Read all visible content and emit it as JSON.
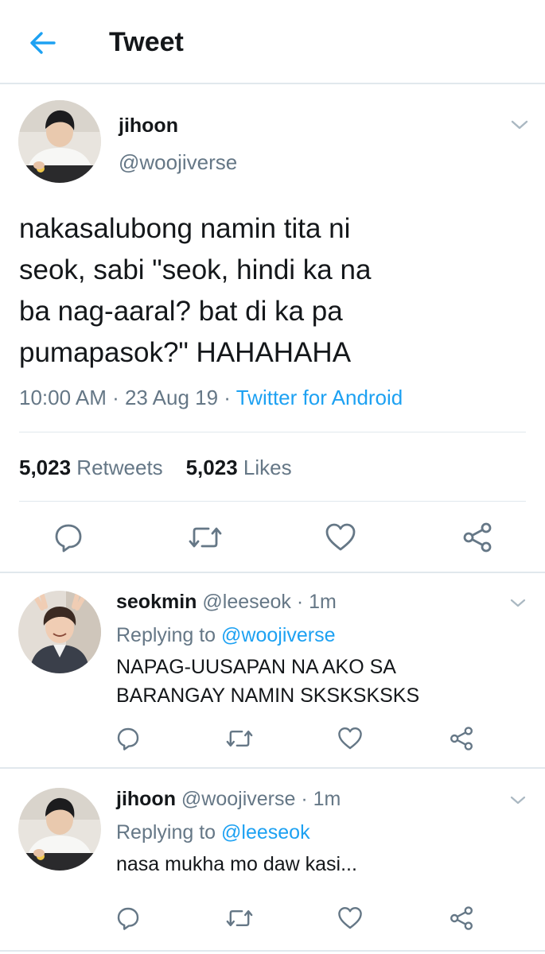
{
  "header": {
    "title": "Tweet"
  },
  "main_tweet": {
    "name": "jihoon",
    "handle": "@woojiverse",
    "text": "nakasalubong namin tita ni\nseok, sabi \"seok, hindi ka na\nba nag-aaral? bat di ka pa\npumapasok?\" HAHAHAHA",
    "time": "10:00 AM · 23 Aug 19 · ",
    "source": "Twitter for Android",
    "retweets_count": "5,023",
    "retweets_label": " Retweets",
    "likes_count": "5,023",
    "likes_label": " Likes"
  },
  "replies": [
    {
      "name": "seokmin",
      "handle_time": " @leeseok · 1m",
      "replying_label": "Replying to ",
      "replying_to": "@woojiverse",
      "text": "NAPAG-UUSAPAN NA AKO SA\nBARANGAY NAMIN SKSKSKSKS"
    },
    {
      "name": "jihoon",
      "handle_time": " @woojiverse · 1m",
      "replying_label": "Replying to ",
      "replying_to": "@leeseok",
      "text": "nasa mukha mo daw kasi..."
    }
  ],
  "icons": {
    "back": "arrow-left-icon",
    "caret": "chevron-down-icon",
    "reply": "reply-icon",
    "retweet": "retweet-icon",
    "like": "heart-icon",
    "share": "share-icon"
  },
  "colors": {
    "accent": "#1da1f2",
    "secondary_text": "#657786",
    "divider": "#e1e8ed",
    "primary_text": "#14171a"
  }
}
